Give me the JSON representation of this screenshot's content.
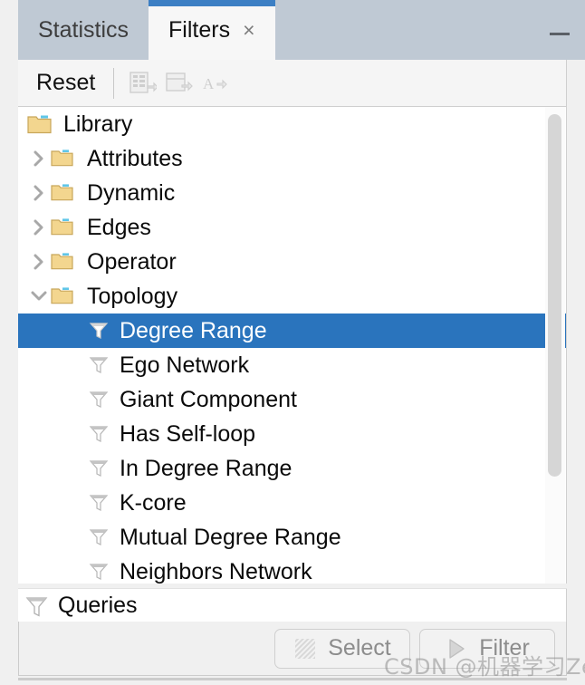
{
  "window": {
    "minimize_label": "—"
  },
  "tabs": [
    {
      "label": "Statistics",
      "active": false,
      "closable": false
    },
    {
      "label": "Filters",
      "active": true,
      "closable": true,
      "close_label": "×"
    }
  ],
  "toolbar": {
    "reset_label": "Reset",
    "icons": [
      {
        "name": "export-table-icon",
        "enabled": false
      },
      {
        "name": "export-column-icon",
        "enabled": false
      },
      {
        "name": "rename-text-icon",
        "enabled": false
      }
    ]
  },
  "tree": {
    "root": {
      "label": "Library",
      "icon": "folder-open-icon"
    },
    "groups": [
      {
        "label": "Attributes",
        "expanded": false,
        "icon": "folder-icon"
      },
      {
        "label": "Dynamic",
        "expanded": false,
        "icon": "folder-icon"
      },
      {
        "label": "Edges",
        "expanded": false,
        "icon": "folder-icon"
      },
      {
        "label": "Operator",
        "expanded": false,
        "icon": "folder-icon"
      },
      {
        "label": "Topology",
        "expanded": true,
        "icon": "folder-icon"
      }
    ],
    "topology_filters": [
      {
        "label": "Degree Range",
        "selected": true,
        "icon": "funnel-icon"
      },
      {
        "label": "Ego Network",
        "selected": false,
        "icon": "funnel-icon"
      },
      {
        "label": "Giant Component",
        "selected": false,
        "icon": "funnel-icon"
      },
      {
        "label": "Has Self-loop",
        "selected": false,
        "icon": "funnel-icon"
      },
      {
        "label": "In Degree Range",
        "selected": false,
        "icon": "funnel-icon"
      },
      {
        "label": "K-core",
        "selected": false,
        "icon": "funnel-icon"
      },
      {
        "label": "Mutual Degree Range",
        "selected": false,
        "icon": "funnel-icon"
      },
      {
        "label": "Neighbors Network",
        "selected": false,
        "icon": "funnel-icon"
      }
    ]
  },
  "queries": {
    "label": "Queries",
    "icon": "funnel-icon"
  },
  "actions": {
    "select_label": "Select",
    "select_icon": "hatched-square-icon",
    "filter_label": "Filter",
    "filter_icon": "play-triangle-icon"
  },
  "watermark": {
    "text": "CSDN @机器学习Zero"
  },
  "colors": {
    "selection_blue": "#2a74bd",
    "tab_active_accent": "#3c7fc4",
    "tabbar_bg": "#bfc9d4",
    "panel_bg": "#f0f0f0",
    "tree_bg": "#ffffff"
  }
}
